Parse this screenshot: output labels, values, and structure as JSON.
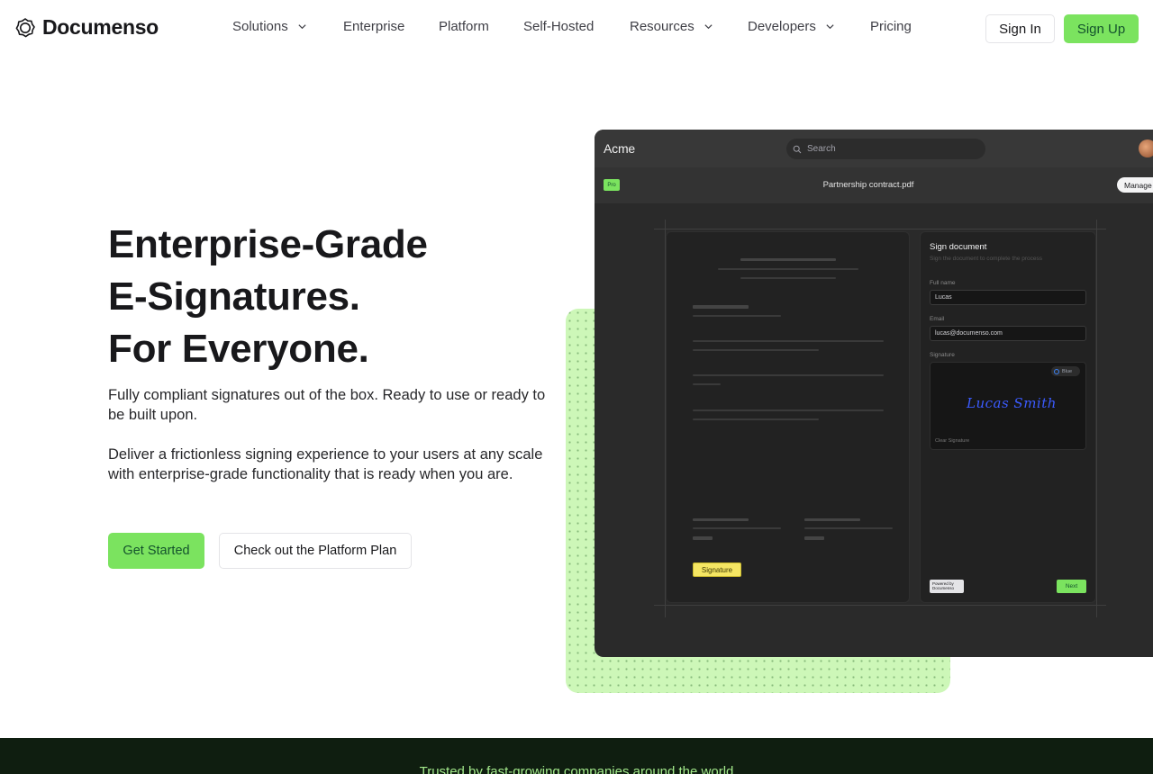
{
  "brand": {
    "name": "Documenso"
  },
  "nav": {
    "items": [
      {
        "label": "Solutions",
        "dropdown": true
      },
      {
        "label": "Enterprise",
        "dropdown": false
      },
      {
        "label": "Platform",
        "dropdown": false
      },
      {
        "label": "Self-Hosted",
        "dropdown": false
      },
      {
        "label": "Resources",
        "dropdown": true
      },
      {
        "label": "Developers",
        "dropdown": true
      },
      {
        "label": "Pricing",
        "dropdown": false
      }
    ],
    "sign_in": "Sign In",
    "sign_up": "Sign Up"
  },
  "hero": {
    "title_lines": [
      "Enterprise-Grade",
      "E-Signatures.",
      "For Everyone."
    ],
    "paragraph1": "Fully compliant signatures out of the box. Ready to use or ready to be built upon.",
    "paragraph2": "Deliver a frictionless signing experience to your users at any scale with enterprise-grade functionality that is ready when you are.",
    "primary_cta": "Get Started",
    "secondary_cta": "Check out the Platform Plan"
  },
  "app_preview": {
    "org_name": "Acme",
    "search_placeholder": "Search",
    "badge": "Pro",
    "document_name": "Partnership contract.pdf",
    "manage_label": "Manage",
    "signature_field_label": "Signature",
    "sign_panel": {
      "title": "Sign document",
      "subtitle": "Sign the document to complete the process",
      "full_name_label": "Full name",
      "full_name_value": "Lucas",
      "email_label": "Email",
      "email_value": "lucas@documenso.com",
      "signature_label": "Signature",
      "color_option": "Blue",
      "signature_text": "Lucas Smith",
      "clear_label": "Clear Signature",
      "powered_by_line1": "Powered by",
      "powered_by_line2": "Documenso",
      "next_label": "Next"
    }
  },
  "band": {
    "text": "Trusted by fast-growing companies around the world"
  },
  "colors": {
    "accent": "#7be35f",
    "dark_band": "#0f1e10",
    "band_text": "#a3e98b",
    "app_bg": "#2a2a2a"
  }
}
